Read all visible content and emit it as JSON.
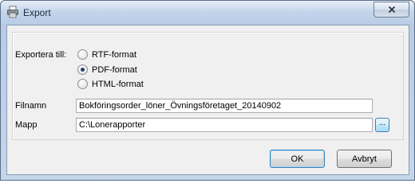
{
  "window": {
    "title": "Export",
    "icon": "printer-icon",
    "close_label": "close-icon"
  },
  "form": {
    "export_to_label": "Exportera till:",
    "formats": [
      {
        "label": "RTF-format",
        "selected": false
      },
      {
        "label": "PDF-format",
        "selected": true
      },
      {
        "label": "HTML-format",
        "selected": false
      }
    ],
    "filename_label": "Filnamn",
    "filename_value": "Bokföringsorder_löner_Övningsföretaget_20140902",
    "folder_label": "Mapp",
    "folder_value": "C:\\Lonerapporter",
    "browse_label": "..."
  },
  "buttons": {
    "ok": "OK",
    "cancel": "Avbryt"
  }
}
